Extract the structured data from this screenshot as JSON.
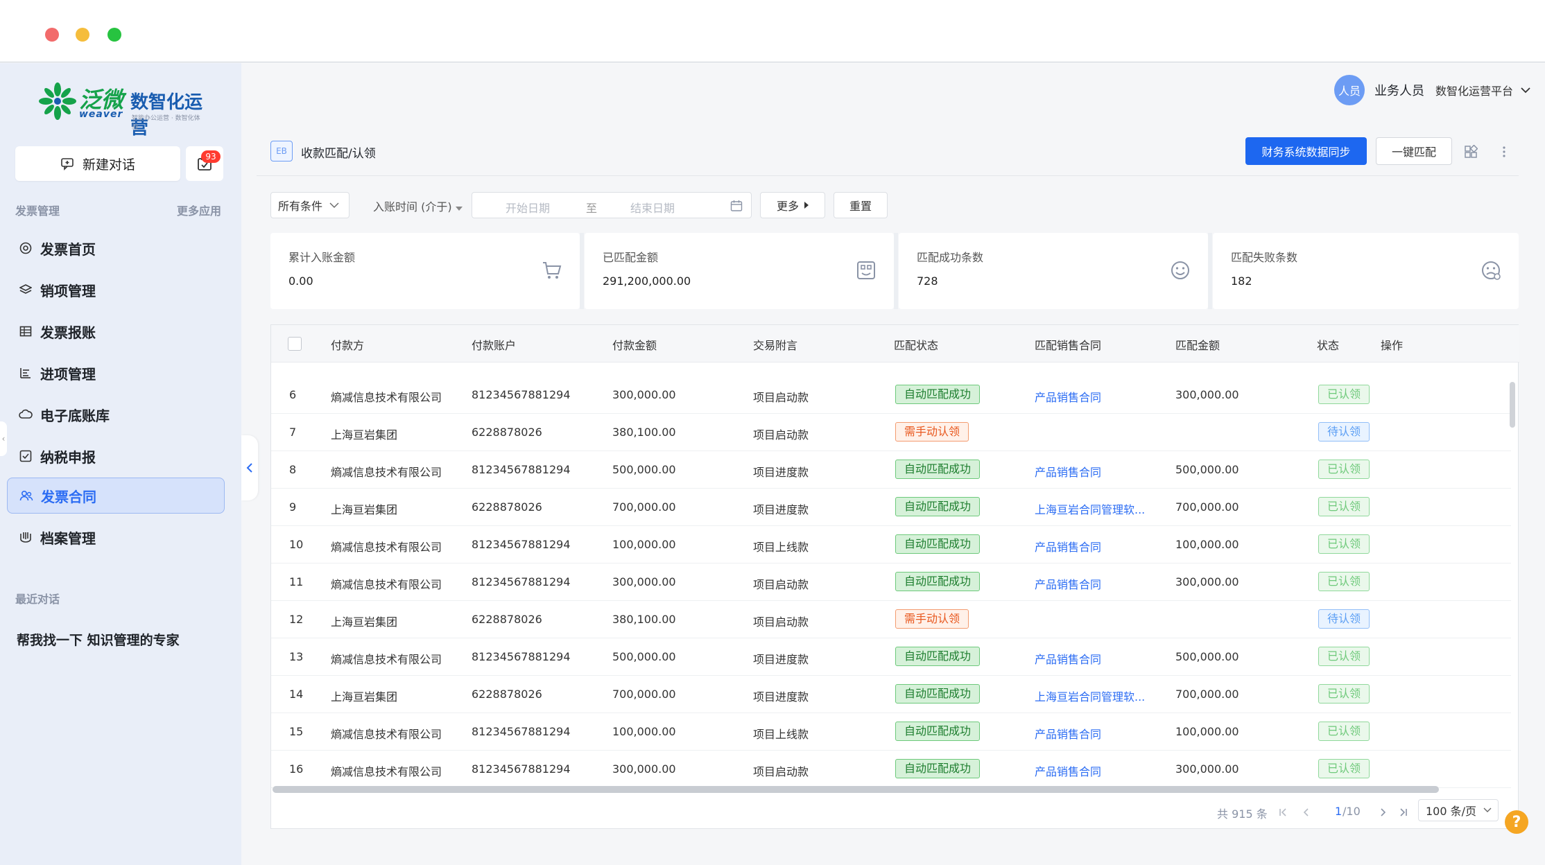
{
  "window": {
    "controls": [
      "close",
      "minimize",
      "maximize"
    ]
  },
  "sidebar": {
    "logo": {
      "brand_cn": "泛微",
      "brand_en": "weaver",
      "product": "数智化运营",
      "tagline": "智能办公运营 · 数智化体验"
    },
    "new_chat_label": "新建对话",
    "todo_badge": "93",
    "section_title": "发票管理",
    "more_apps": "更多应用",
    "items": [
      {
        "label": "发票首页",
        "icon": "target-icon"
      },
      {
        "label": "销项管理",
        "icon": "layers-icon"
      },
      {
        "label": "发票报账",
        "icon": "table-icon"
      },
      {
        "label": "进项管理",
        "icon": "bar-list-icon"
      },
      {
        "label": "电子底账库",
        "icon": "cloud-icon"
      },
      {
        "label": "纳税申报",
        "icon": "checkbox-icon"
      },
      {
        "label": "发票合同",
        "icon": "users-icon",
        "active": true
      },
      {
        "label": "档案管理",
        "icon": "archive-icon"
      }
    ],
    "recent_title": "最近对话",
    "recent_items": [
      "帮我找一下 知识管理的专家"
    ]
  },
  "header": {
    "avatar_text": "人员",
    "user_name": "业务人员",
    "platform": "数智化运营平台"
  },
  "page": {
    "badge": "EB",
    "title": "收款匹配/认领",
    "primary_button": "财务系统数据同步",
    "secondary_button": "一键匹配"
  },
  "filters": {
    "condition": "所有条件",
    "date_label": "入账时间 (介于)",
    "start_placeholder": "开始日期",
    "to": "至",
    "end_placeholder": "结束日期",
    "more": "更多",
    "reset": "重置"
  },
  "cards": [
    {
      "label": "累计入账金额",
      "value": "0.00",
      "icon": "cart-icon"
    },
    {
      "label": "已匹配金额",
      "value": "291,200,000.00",
      "icon": "matched-icon"
    },
    {
      "label": "匹配成功条数",
      "value": "728",
      "icon": "smile-icon"
    },
    {
      "label": "匹配失败条数",
      "value": "182",
      "icon": "sad-icon"
    }
  ],
  "table": {
    "columns": [
      "付款方",
      "付款账户",
      "付款金额",
      "交易附言",
      "匹配状态",
      "匹配销售合同",
      "匹配金额",
      "状态",
      "操作"
    ],
    "rows": [
      {
        "no": "6",
        "payer": "熵减信息技术有限公司",
        "account": "81234567881294",
        "amount": "300,000.00",
        "memo": "项目启动款",
        "match": "自动匹配成功",
        "match_type": "ok",
        "contract": "产品销售合同",
        "matched_amount": "300,000.00",
        "status": "已认领",
        "status_type": "claimed"
      },
      {
        "no": "7",
        "payer": "上海亘岩集团",
        "account": "6228878026",
        "amount": "380,100.00",
        "memo": "项目启动款",
        "match": "需手动认领",
        "match_type": "manual",
        "contract": "",
        "matched_amount": "",
        "status": "待认领",
        "status_type": "pending"
      },
      {
        "no": "8",
        "payer": "熵减信息技术有限公司",
        "account": "81234567881294",
        "amount": "500,000.00",
        "memo": "项目进度款",
        "match": "自动匹配成功",
        "match_type": "ok",
        "contract": "产品销售合同",
        "matched_amount": "500,000.00",
        "status": "已认领",
        "status_type": "claimed"
      },
      {
        "no": "9",
        "payer": "上海亘岩集团",
        "account": "6228878026",
        "amount": "700,000.00",
        "memo": "项目进度款",
        "match": "自动匹配成功",
        "match_type": "ok",
        "contract": "上海亘岩合同管理软...",
        "matched_amount": "700,000.00",
        "status": "已认领",
        "status_type": "claimed"
      },
      {
        "no": "10",
        "payer": "熵减信息技术有限公司",
        "account": "81234567881294",
        "amount": "100,000.00",
        "memo": "项目上线款",
        "match": "自动匹配成功",
        "match_type": "ok",
        "contract": "产品销售合同",
        "matched_amount": "100,000.00",
        "status": "已认领",
        "status_type": "claimed"
      },
      {
        "no": "11",
        "payer": "熵减信息技术有限公司",
        "account": "81234567881294",
        "amount": "300,000.00",
        "memo": "项目启动款",
        "match": "自动匹配成功",
        "match_type": "ok",
        "contract": "产品销售合同",
        "matched_amount": "300,000.00",
        "status": "已认领",
        "status_type": "claimed"
      },
      {
        "no": "12",
        "payer": "上海亘岩集团",
        "account": "6228878026",
        "amount": "380,100.00",
        "memo": "项目启动款",
        "match": "需手动认领",
        "match_type": "manual",
        "contract": "",
        "matched_amount": "",
        "status": "待认领",
        "status_type": "pending"
      },
      {
        "no": "13",
        "payer": "熵减信息技术有限公司",
        "account": "81234567881294",
        "amount": "500,000.00",
        "memo": "项目进度款",
        "match": "自动匹配成功",
        "match_type": "ok",
        "contract": "产品销售合同",
        "matched_amount": "500,000.00",
        "status": "已认领",
        "status_type": "claimed"
      },
      {
        "no": "14",
        "payer": "上海亘岩集团",
        "account": "6228878026",
        "amount": "700,000.00",
        "memo": "项目进度款",
        "match": "自动匹配成功",
        "match_type": "ok",
        "contract": "上海亘岩合同管理软...",
        "matched_amount": "700,000.00",
        "status": "已认领",
        "status_type": "claimed"
      },
      {
        "no": "15",
        "payer": "熵减信息技术有限公司",
        "account": "81234567881294",
        "amount": "100,000.00",
        "memo": "项目上线款",
        "match": "自动匹配成功",
        "match_type": "ok",
        "contract": "产品销售合同",
        "matched_amount": "100,000.00",
        "status": "已认领",
        "status_type": "claimed"
      },
      {
        "no": "16",
        "payer": "熵减信息技术有限公司",
        "account": "81234567881294",
        "amount": "300,000.00",
        "memo": "项目启动款",
        "match": "自动匹配成功",
        "match_type": "ok",
        "contract": "产品销售合同",
        "matched_amount": "300,000.00",
        "status": "已认领",
        "status_type": "claimed"
      }
    ]
  },
  "pagination": {
    "total": "共 915 条",
    "current": "1",
    "pages": "/10",
    "page_size": "100 条/页"
  },
  "help_label": "?",
  "colors": {
    "primary": "#1d67f0",
    "success": "#1c7d2d",
    "warning": "#e8571d",
    "link": "#2b6cf3"
  }
}
